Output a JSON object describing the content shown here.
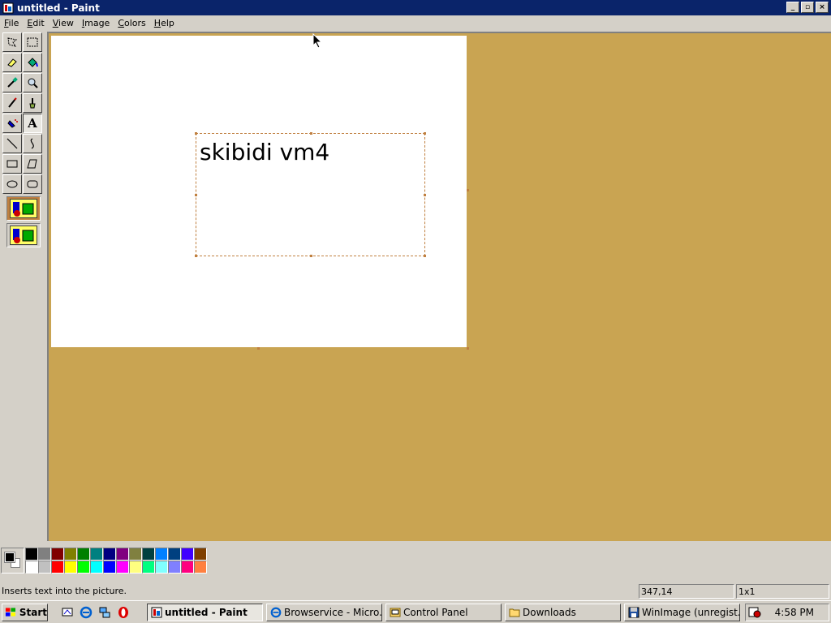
{
  "window": {
    "title": "untitled - Paint",
    "minimize_glyph": "_",
    "restore_glyph": "▫",
    "close_glyph": "×"
  },
  "menu": [
    {
      "label": "File"
    },
    {
      "label": "Edit"
    },
    {
      "label": "View"
    },
    {
      "label": "Image"
    },
    {
      "label": "Colors"
    },
    {
      "label": "Help"
    }
  ],
  "tools": [
    {
      "name": "free-select-icon"
    },
    {
      "name": "select-icon"
    },
    {
      "name": "eraser-icon"
    },
    {
      "name": "fill-icon"
    },
    {
      "name": "pick-color-icon"
    },
    {
      "name": "magnifier-icon"
    },
    {
      "name": "pencil-icon"
    },
    {
      "name": "brush-icon"
    },
    {
      "name": "airbrush-icon"
    },
    {
      "name": "text-icon",
      "label": "A",
      "active": true
    },
    {
      "name": "line-icon"
    },
    {
      "name": "curve-icon"
    },
    {
      "name": "rectangle-icon"
    },
    {
      "name": "polygon-icon"
    },
    {
      "name": "ellipse-icon"
    },
    {
      "name": "rounded-rectangle-icon"
    }
  ],
  "canvas": {
    "text": "skibidi vm4",
    "background": "#ffffff",
    "workspace_color": "#c9a452"
  },
  "palette": {
    "foreground": "#000000",
    "background": "#ffffff",
    "colors": [
      "#000000",
      "#808080",
      "#800000",
      "#808000",
      "#008000",
      "#008080",
      "#000080",
      "#800080",
      "#808040",
      "#004040",
      "#0080ff",
      "#004080",
      "#4000ff",
      "#804000",
      "#ffffff",
      "#c0c0c0",
      "#ff0000",
      "#ffff00",
      "#00ff00",
      "#00ffff",
      "#0000ff",
      "#ff00ff",
      "#ffff80",
      "#00ff80",
      "#80ffff",
      "#8080ff",
      "#ff0080",
      "#ff8040"
    ]
  },
  "status": {
    "message": "Inserts text into the picture.",
    "coords": "347,14",
    "size": "1x1"
  },
  "taskbar": {
    "start_label": "Start",
    "buttons": [
      {
        "label": "untitled - Paint",
        "active": true
      },
      {
        "label": "Browservice - Micro..."
      },
      {
        "label": "Control Panel"
      },
      {
        "label": "Downloads"
      },
      {
        "label": "WinImage (unregist..."
      }
    ],
    "clock": "4:58 PM"
  }
}
